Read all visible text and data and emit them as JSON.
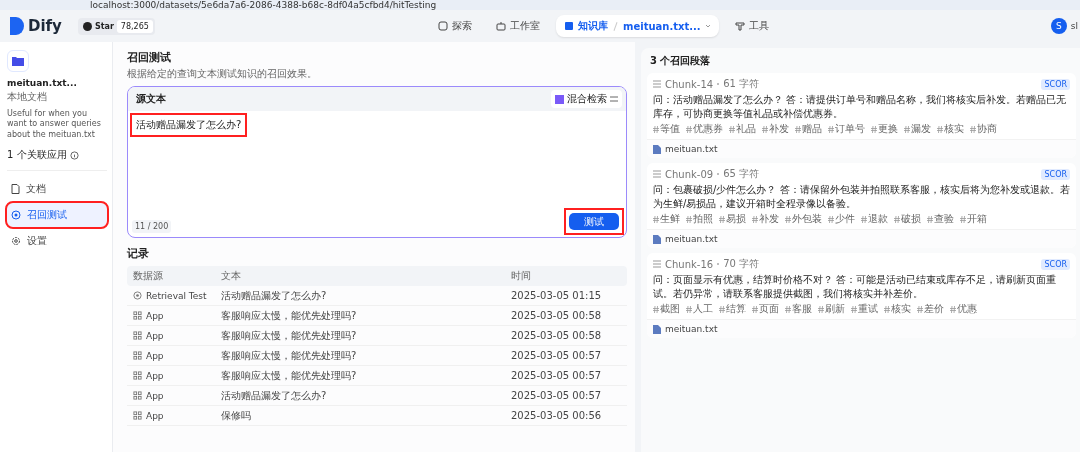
{
  "browser": {
    "url": "localhost:3000/datasets/5e6da7a6-2086-4388-b68c-8df04a5cfbd4/hitTesting"
  },
  "header": {
    "logo": "Dify",
    "star_label": "Star",
    "star_count": "78,265",
    "nav": [
      {
        "label": "探索",
        "selected": false,
        "kind": "explore"
      },
      {
        "label": "工作室",
        "selected": false,
        "kind": "studio"
      },
      {
        "label": "知识库",
        "selected": true,
        "kind": "knowledge",
        "crumb": "meituan.txt..."
      },
      {
        "label": "工具",
        "selected": false,
        "kind": "tools"
      }
    ],
    "user": {
      "initial": "S",
      "name": "sl"
    }
  },
  "sidebar": {
    "name": "meituan.txt...",
    "type": "本地文档",
    "description": "Useful for when you want to answer queries about the meituan.txt",
    "apps": "1 个关联应用",
    "items": [
      {
        "label": "文档",
        "kind": "doc",
        "selected": false,
        "highlighted": false
      },
      {
        "label": "召回测试",
        "kind": "target",
        "selected": true,
        "highlighted": true
      },
      {
        "label": "设置",
        "kind": "gear",
        "selected": false,
        "highlighted": false
      }
    ]
  },
  "main": {
    "title": "召回测试",
    "subtitle": "根据给定的查询文本测试知识的召回效果。",
    "query": {
      "label": "源文本",
      "mode": "混合检索",
      "value": "活动赠品漏发了怎么办?",
      "value_highlighted": true,
      "count": "11 / 200",
      "button": "测试",
      "button_highlighted": true
    },
    "records": {
      "title": "记录",
      "columns": [
        "数据源",
        "文本",
        "时间"
      ],
      "rows": [
        {
          "source": "Retrieval Test",
          "kind": "retrieval",
          "text": "活动赠品漏发了怎么办?",
          "time": "2025-03-05 01:15"
        },
        {
          "source": "App",
          "kind": "app",
          "text": "客服响应太慢，能优先处理吗?",
          "time": "2025-03-05 00:58"
        },
        {
          "source": "App",
          "kind": "app",
          "text": "客服响应太慢，能优先处理吗?",
          "time": "2025-03-05 00:58"
        },
        {
          "source": "App",
          "kind": "app",
          "text": "客服响应太慢，能优先处理吗?",
          "time": "2025-03-05 00:57"
        },
        {
          "source": "App",
          "kind": "app",
          "text": "客服响应太慢，能优先处理吗?",
          "time": "2025-03-05 00:57"
        },
        {
          "source": "App",
          "kind": "app",
          "text": "活动赠品漏发了怎么办?",
          "time": "2025-03-05 00:57"
        },
        {
          "source": "App",
          "kind": "app",
          "text": "保修吗",
          "time": "2025-03-05 00:56"
        }
      ]
    }
  },
  "results": {
    "title": "3 个召回段落",
    "chunks": [
      {
        "id": "Chunk-14",
        "chars": "61 字符",
        "score": "SCOR",
        "content": "问：活动赠品漏发了怎么办？ 答：请提供订单号和赠品名称，我们将核实后补发。若赠品已无库存，可协商更换等值礼品或补偿优惠券。",
        "keywords": [
          "等值",
          "优惠券",
          "礼品",
          "补发",
          "赠品",
          "订单号",
          "更换",
          "漏发",
          "核实",
          "协商"
        ],
        "file": "meituan.txt"
      },
      {
        "id": "Chunk-09",
        "chars": "65 字符",
        "score": "SCOR",
        "content": "问：包裹破损/少件怎么办？ 答：请保留外包装并拍照联系客服，核实后将为您补发或退款。若为生鲜/易损品，建议开箱时全程录像以备验。",
        "keywords": [
          "生鲜",
          "拍照",
          "易损",
          "补发",
          "外包装",
          "少件",
          "退款",
          "破损",
          "查验",
          "开箱"
        ],
        "file": "meituan.txt"
      },
      {
        "id": "Chunk-16",
        "chars": "70 字符",
        "score": "SCOR",
        "content": "问：页面显示有优惠，结算时价格不对？ 答：可能是活动已结束或库存不足，请刷新页面重试。若仍异常，请联系客服提供截图，我们将核实并补差价。",
        "keywords": [
          "截图",
          "人工",
          "结算",
          "页面",
          "客服",
          "刷新",
          "重试",
          "核实",
          "差价",
          "优惠"
        ],
        "file": "meituan.txt"
      }
    ]
  }
}
